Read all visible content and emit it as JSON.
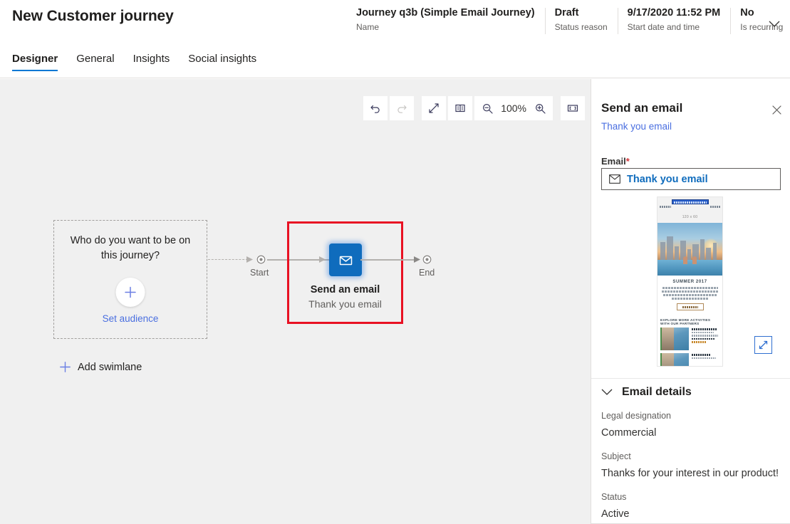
{
  "header": {
    "title": "New Customer journey",
    "meta": [
      {
        "value": "Journey q3b (Simple Email Journey)",
        "label": "Name"
      },
      {
        "value": "Draft",
        "label": "Status reason"
      },
      {
        "value": "9/17/2020 11:52 PM",
        "label": "Start date and time"
      },
      {
        "value": "No",
        "label": "Is recurring"
      }
    ],
    "chevron_icon": "chevron-down-icon"
  },
  "tabs": [
    {
      "label": "Designer",
      "active": true
    },
    {
      "label": "General",
      "active": false
    },
    {
      "label": "Insights",
      "active": false
    },
    {
      "label": "Social insights",
      "active": false
    }
  ],
  "toolbar": {
    "undo_icon": "undo-icon",
    "redo_icon": "redo-icon",
    "expand_icon": "expand-diagonal-icon",
    "map_icon": "map-icon",
    "zoom_out_icon": "zoom-out-icon",
    "zoom_level": "100%",
    "zoom_in_icon": "zoom-in-icon",
    "fit_icon": "fit-to-screen-icon"
  },
  "canvas": {
    "swimlane": {
      "question": "Who do you want to be on this journey?",
      "plus_icon": "plus-icon",
      "set_audience_label": "Set audience"
    },
    "add_swimlane": {
      "plus_icon": "plus-icon",
      "label": "Add swimlane"
    },
    "start_node_label": "Start",
    "end_node_label": "End",
    "tile": {
      "icon": "envelope-icon",
      "title": "Send an email",
      "subtitle": "Thank you email",
      "selection_color": "#e81123",
      "icon_bg_color": "#0f6cbd"
    }
  },
  "panel": {
    "title": "Send an email",
    "subtitle": "Thank you email",
    "close_icon": "close-icon",
    "email_field": {
      "label": "Email",
      "required_marker": "*",
      "icon": "envelope-icon",
      "value": "Thank you email"
    },
    "preview": {
      "placeholder_dimensions": "120 x 60",
      "heading": "SUMMER 2017",
      "section_heading": "EXPLORE MORE ACTIVITIES WITH OUR PARTNERS",
      "expand_icon": "expand-diagonal-icon"
    },
    "details": {
      "chevron_icon": "chevron-down-icon",
      "heading": "Email details",
      "fields": [
        {
          "label": "Legal designation",
          "value": "Commercial"
        },
        {
          "label": "Subject",
          "value": "Thanks for your interest in our product!"
        },
        {
          "label": "Status",
          "value": "Active"
        }
      ]
    }
  }
}
